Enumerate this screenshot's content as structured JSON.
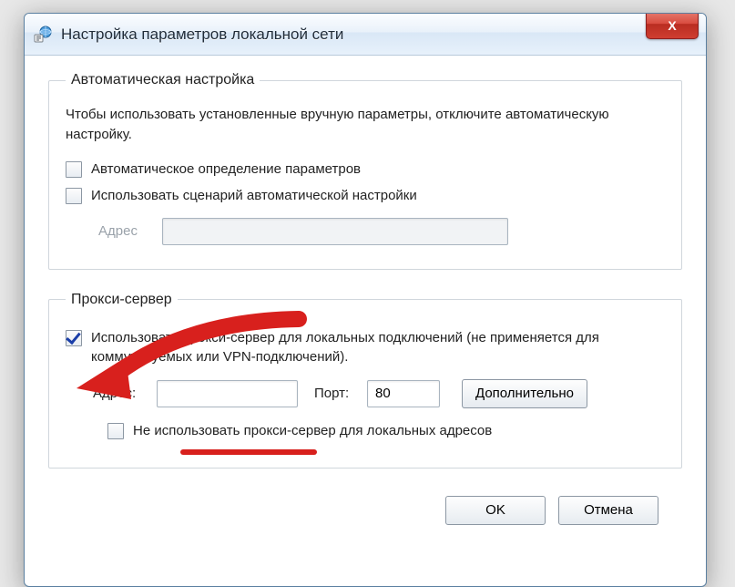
{
  "window": {
    "title": "Настройка параметров локальной сети",
    "close_symbol": "X"
  },
  "auto": {
    "legend": "Автоматическая настройка",
    "description": "Чтобы использовать установленные вручную параметры, отключите автоматическую настройку.",
    "detect_label": "Автоматическое определение параметров",
    "detect_checked": false,
    "script_label": "Использовать сценарий автоматической настройки",
    "script_checked": false,
    "address_label": "Адрес",
    "address_value": ""
  },
  "proxy": {
    "legend": "Прокси-сервер",
    "use_label": "Использовать прокси-сервер для локальных подключений (не применяется для коммутируемых или VPN-подключений).",
    "use_checked": true,
    "address_label": "Адрес:",
    "address_value": "",
    "port_label": "Порт:",
    "port_value": "80",
    "advanced_label": "Дополнительно",
    "bypass_label": "Не использовать прокси-сервер для локальных адресов",
    "bypass_checked": false
  },
  "buttons": {
    "ok": "OK",
    "cancel": "Отмена"
  }
}
